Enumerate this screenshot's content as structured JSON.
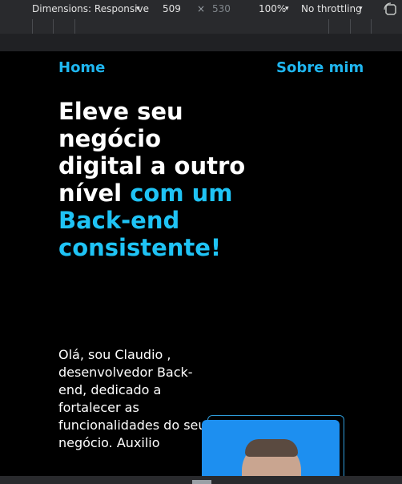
{
  "devtools": {
    "dimensions_label": "Dimensions: Responsive",
    "width": "509",
    "times": "×",
    "height": "530",
    "zoom": "100%",
    "throttling": "No throttling",
    "caret": "▾"
  },
  "nav": {
    "home": "Home",
    "about": "Sobre mim"
  },
  "hero": {
    "headline_white": "Eleve seu negócio digital a outro nível ",
    "headline_accent": "com um Back-end consistente!",
    "intro": "Olá, sou Claudio , desenvolvedor Back-end, dedicado a fortalecer as funcionalidades do seu negócio. Auxilio"
  },
  "colors": {
    "accent": "#1fc3f5",
    "background": "#000000",
    "photo_bg": "#1d8ff0"
  },
  "icons": {
    "rotate": "rotate-icon",
    "avatar": "avatar-photo"
  }
}
